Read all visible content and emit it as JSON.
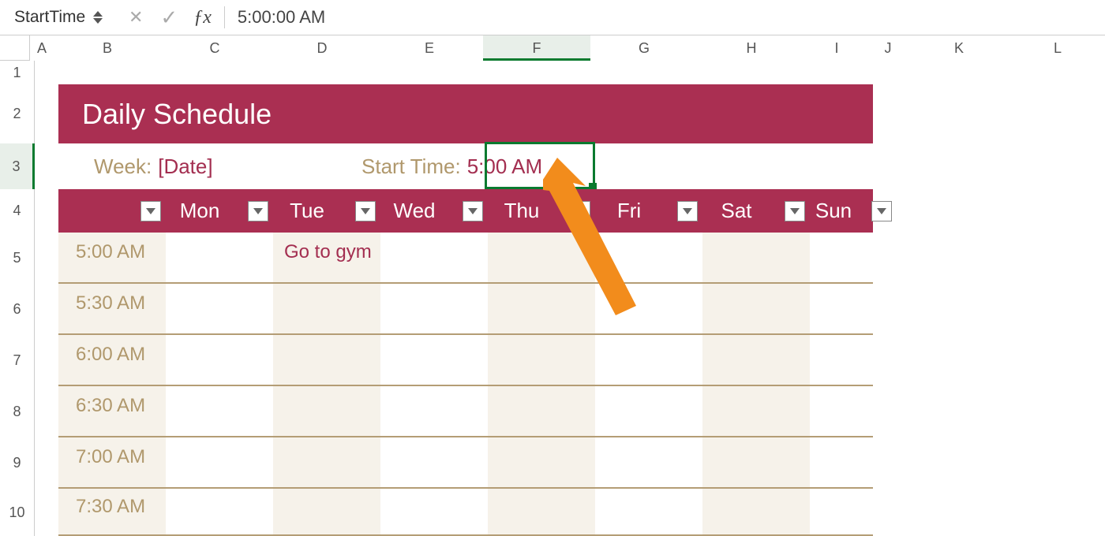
{
  "formula_bar": {
    "name_box": "StartTime",
    "value": "5:00:00 AM"
  },
  "columns": [
    "A",
    "B",
    "C",
    "D",
    "E",
    "F",
    "G",
    "H",
    "I",
    "J",
    "K",
    "L"
  ],
  "selected_column": "F",
  "rows": [
    "1",
    "2",
    "3",
    "4",
    "5",
    "6",
    "7",
    "8",
    "9",
    "10"
  ],
  "selected_row": "3",
  "schedule": {
    "title": "Daily Schedule",
    "week_label": "Week:",
    "week_value": "[Date]",
    "start_time_label": "Start Time:",
    "start_time_value": "5:00 AM",
    "days": [
      "Mon",
      "Tue",
      "Wed",
      "Thu",
      "Fri",
      "Sat",
      "Sun"
    ],
    "time_slots": [
      "5:00 AM",
      "5:30 AM",
      "6:00 AM",
      "6:30 AM",
      "7:00 AM",
      "7:30 AM"
    ],
    "entries": [
      {
        "day_index": 1,
        "slot_index": 0,
        "text": "Go to gym"
      }
    ]
  },
  "colors": {
    "brand": "#aa2f52",
    "label": "#b0986c",
    "value": "#a32e50",
    "shadeCol": "#f6f2ea"
  }
}
